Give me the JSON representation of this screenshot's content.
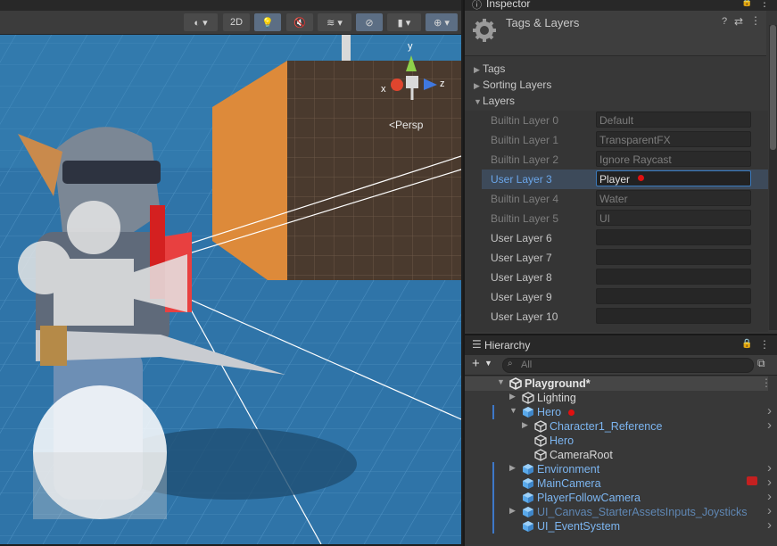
{
  "scene": {
    "toolbar": {
      "mode_2d_label": "2D"
    },
    "camera_label": "Persp",
    "gizmo_axes": {
      "x": "x",
      "y": "y",
      "z": "z"
    }
  },
  "inspector": {
    "tab_label": "Inspector",
    "title": "Tags & Layers",
    "sections": {
      "tags": "Tags",
      "sorting_layers": "Sorting Layers",
      "layers": "Layers"
    },
    "layers": [
      {
        "label": "Builtin Layer 0",
        "value": "Default",
        "kind": "builtin"
      },
      {
        "label": "Builtin Layer 1",
        "value": "TransparentFX",
        "kind": "builtin"
      },
      {
        "label": "Builtin Layer 2",
        "value": "Ignore Raycast",
        "kind": "builtin"
      },
      {
        "label": "User Layer 3",
        "value": "Player",
        "kind": "selected"
      },
      {
        "label": "Builtin Layer 4",
        "value": "Water",
        "kind": "builtin"
      },
      {
        "label": "Builtin Layer 5",
        "value": "UI",
        "kind": "builtin"
      },
      {
        "label": "User Layer 6",
        "value": "",
        "kind": "user"
      },
      {
        "label": "User Layer 7",
        "value": "",
        "kind": "user"
      },
      {
        "label": "User Layer 8",
        "value": "",
        "kind": "user"
      },
      {
        "label": "User Layer 9",
        "value": "",
        "kind": "user"
      },
      {
        "label": "User Layer 10",
        "value": "",
        "kind": "user"
      }
    ],
    "colors": {
      "accent": "#3a79bb",
      "marker": "#e01010"
    }
  },
  "hierarchy": {
    "tab_label": "Hierarchy",
    "search_placeholder": "All",
    "items": [
      {
        "name": "Playground*",
        "style": "bold",
        "icon": "unity-scene-icon"
      },
      {
        "name": "Lighting",
        "style": "plain",
        "icon": "gameobject-icon"
      },
      {
        "name": "Hero",
        "style": "prefab",
        "icon": "prefab-cube-icon"
      },
      {
        "name": "Character1_Reference",
        "style": "prefab",
        "icon": "gameobject-icon"
      },
      {
        "name": "Hero",
        "style": "prefab",
        "icon": "gameobject-icon"
      },
      {
        "name": "CameraRoot",
        "style": "plain",
        "icon": "gameobject-icon"
      },
      {
        "name": "Environment",
        "style": "prefab",
        "icon": "prefab-cube-icon"
      },
      {
        "name": "MainCamera",
        "style": "prefab",
        "icon": "prefab-cube-icon"
      },
      {
        "name": "PlayerFollowCamera",
        "style": "prefab",
        "icon": "prefab-cube-icon"
      },
      {
        "name": "UI_Canvas_StarterAssetsInputs_Joysticks",
        "style": "dim",
        "icon": "prefab-cube-icon"
      },
      {
        "name": "UI_EventSystem",
        "style": "prefab",
        "icon": "prefab-cube-icon"
      }
    ]
  }
}
